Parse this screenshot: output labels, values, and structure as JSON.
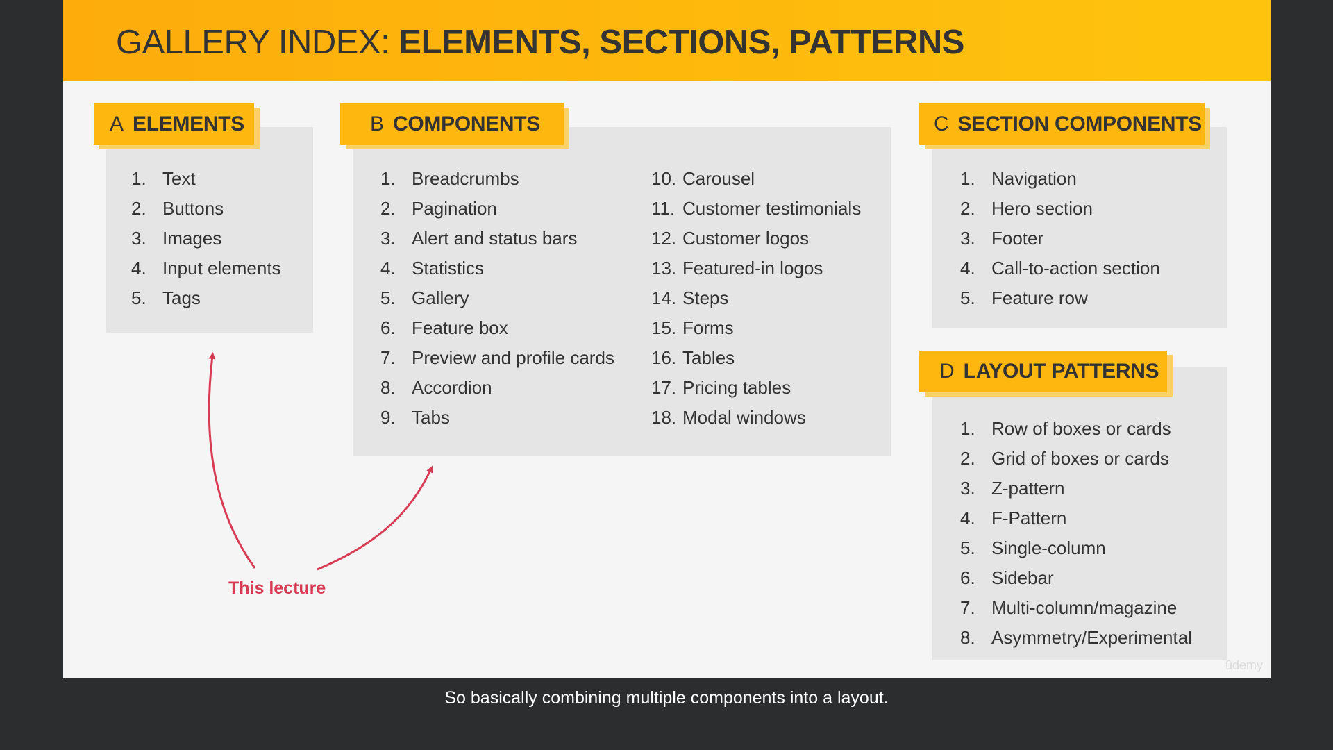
{
  "slide": {
    "title_light": "GALLERY INDEX:",
    "title_bold": "ELEMENTS, SECTIONS, PATTERNS"
  },
  "sections": {
    "a": {
      "letter": "A",
      "name": "ELEMENTS",
      "items": [
        {
          "num": "1.",
          "text": "Text"
        },
        {
          "num": "2.",
          "text": "Buttons"
        },
        {
          "num": "3.",
          "text": "Images"
        },
        {
          "num": "4.",
          "text": "Input elements"
        },
        {
          "num": "5.",
          "text": "Tags"
        }
      ]
    },
    "b": {
      "letter": "B",
      "name": "COMPONENTS",
      "col1": [
        {
          "num": "1.",
          "text": "Breadcrumbs"
        },
        {
          "num": "2.",
          "text": "Pagination"
        },
        {
          "num": "3.",
          "text": "Alert and status bars"
        },
        {
          "num": "4.",
          "text": "Statistics"
        },
        {
          "num": "5.",
          "text": "Gallery"
        },
        {
          "num": "6.",
          "text": "Feature box"
        },
        {
          "num": "7.",
          "text": "Preview and profile cards"
        },
        {
          "num": "8.",
          "text": "Accordion"
        },
        {
          "num": "9.",
          "text": "Tabs"
        }
      ],
      "col2": [
        {
          "num": "10.",
          "text": "Carousel"
        },
        {
          "num": "11.",
          "text": "Customer testimonials"
        },
        {
          "num": "12.",
          "text": "Customer logos"
        },
        {
          "num": "13.",
          "text": "Featured-in logos"
        },
        {
          "num": "14.",
          "text": "Steps"
        },
        {
          "num": "15.",
          "text": "Forms"
        },
        {
          "num": "16.",
          "text": "Tables"
        },
        {
          "num": "17.",
          "text": "Pricing tables"
        },
        {
          "num": "18.",
          "text": "Modal windows"
        }
      ]
    },
    "c": {
      "letter": "C",
      "name": "SECTION COMPONENTS",
      "items": [
        {
          "num": "1.",
          "text": "Navigation"
        },
        {
          "num": "2.",
          "text": "Hero section"
        },
        {
          "num": "3.",
          "text": "Footer"
        },
        {
          "num": "4.",
          "text": "Call-to-action section"
        },
        {
          "num": "5.",
          "text": "Feature row"
        }
      ]
    },
    "d": {
      "letter": "D",
      "name": "LAYOUT PATTERNS",
      "items": [
        {
          "num": "1.",
          "text": "Row of boxes or cards"
        },
        {
          "num": "2.",
          "text": "Grid of boxes or cards"
        },
        {
          "num": "3.",
          "text": "Z-pattern"
        },
        {
          "num": "4.",
          "text": "F-Pattern"
        },
        {
          "num": "5.",
          "text": "Single-column"
        },
        {
          "num": "6.",
          "text": "Sidebar"
        },
        {
          "num": "7.",
          "text": "Multi-column/magazine"
        },
        {
          "num": "8.",
          "text": "Asymmetry/Experimental"
        }
      ]
    }
  },
  "annotation": {
    "label": "This lecture",
    "color": "#d83c54"
  },
  "watermark": "ûdemy",
  "caption": "So basically combining multiple components into a layout.",
  "colors": {
    "header_start": "#fdac0c",
    "header_end": "#fec40d",
    "label_bg": "#fdb70e",
    "panel_bg": "#e5e5e5",
    "slide_bg": "#f5f5f5",
    "frame_bg": "#2c2d2f"
  }
}
